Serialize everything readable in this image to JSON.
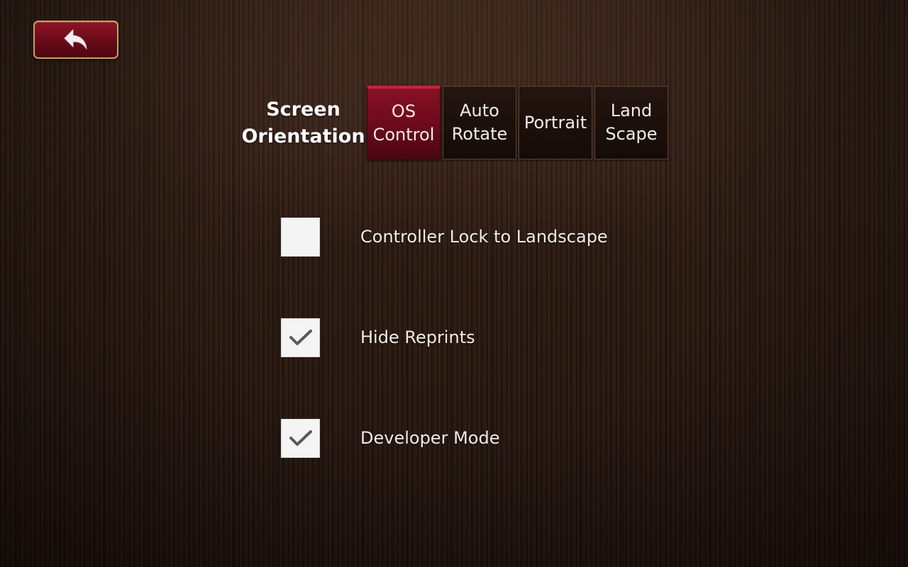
{
  "header": {
    "back_icon": "back-arrow-icon"
  },
  "orientation": {
    "label_line1": "Screen",
    "label_line2": "Orientation",
    "options": [
      {
        "label": "OS\nControl",
        "selected": true
      },
      {
        "label": "Auto\nRotate",
        "selected": false
      },
      {
        "label": "Portrait",
        "selected": false
      },
      {
        "label": "Land\nScape",
        "selected": false
      }
    ]
  },
  "settings": [
    {
      "label": "Controller Lock to Landscape",
      "checked": false
    },
    {
      "label": "Hide Reprints",
      "checked": true
    },
    {
      "label": "Developer Mode",
      "checked": true
    }
  ],
  "colors": {
    "accent": "#8a1126",
    "accent_top": "#e0183a",
    "back_border": "#c9a05a",
    "checkbox_bg": "#f4f4f4",
    "checkmark": "#5a5a5a"
  }
}
